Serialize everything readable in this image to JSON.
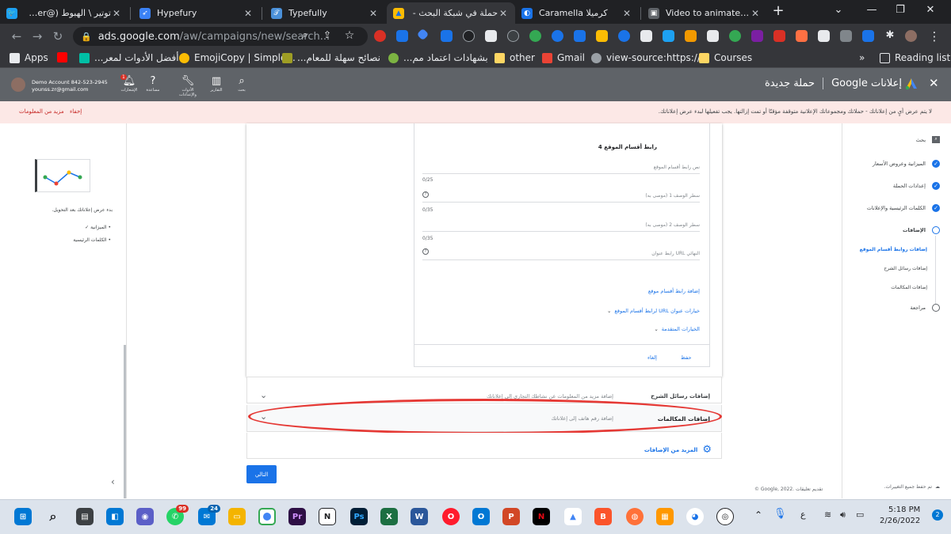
{
  "tabs": [
    {
      "label": "توتير \\ الهبوط (@anszaher",
      "icon": "twitter-icon"
    },
    {
      "label": "Hypefury",
      "icon": "hypefury-icon"
    },
    {
      "label": "Typefully",
      "icon": "typefully-icon"
    },
    {
      "label": "حملة في شبكة البحث -",
      "icon": "google-ads-icon",
      "active": true
    },
    {
      "label": "Caramella كرميلا",
      "icon": "caramella-icon"
    },
    {
      "label": "Video to animated GIF",
      "icon": "video-gif-icon"
    }
  ],
  "address": {
    "host": "ads.google.com",
    "path": "/aw/campaigns/new/search..."
  },
  "bookmarks": [
    "Apps",
    "أفضل الأدوات لمعر...",
    "EmojiCopy | Simple...",
    "نصائح سهلة للمعام...",
    "بشهادات اعتماد مم...",
    "other",
    "Gmail",
    "view-source:https://...",
    "Courses"
  ],
  "reading_list": "Reading list",
  "ads_header": {
    "product": "إعلانات Google",
    "page_title": "حملة جديدة",
    "account": "Demo Account 842-523-2945",
    "email": "younss.zr@gmail.com",
    "notification_count": "1",
    "icons": [
      {
        "name": "notifications-icon",
        "label": "الإشعارات"
      },
      {
        "name": "help-icon",
        "label": "مساعدة"
      },
      {
        "name": "tools-icon",
        "label": "الأدوات والإعدادات"
      },
      {
        "name": "reports-icon",
        "label": "التقارير"
      },
      {
        "name": "search-icon",
        "label": "بحث"
      }
    ]
  },
  "alert": {
    "message": "لا يتم عرض أيٍ من إعلاناتك - حملاتك ومجموعاتك الإعلانية متوقفة مؤقتًا أو تمت إزالتها. يجب تفعيلها لبدء عرض إعلاناتك.",
    "dismiss": "إخفاء",
    "more": "مزيد من المعلومات"
  },
  "left_nav": {
    "search": "بحث",
    "items": [
      {
        "label": "الميزانية وعروض الأسعار",
        "state": "done"
      },
      {
        "label": "إعدادات الحملة",
        "state": "done"
      },
      {
        "label": "الكلمات الرئيسية والإعلانات",
        "state": "done"
      },
      {
        "label": "الإضافات",
        "state": "current"
      },
      {
        "label": "مراجعة",
        "state": "todo"
      }
    ],
    "sub_items": [
      "إضافات روابط أقسام الموقع",
      "إضافات رسائل الشرح",
      "إضافات المكالمات"
    ],
    "saved": "تم حفظ جميع التغييرات."
  },
  "preview": {
    "caption": "بدء عرض إعلاناتك بعد التحويل.",
    "bullets": [
      "الميزانية ✓",
      "الكلمات الرئيسية"
    ]
  },
  "sitelink": {
    "title": "رابط أقسام الموقع 4",
    "text_placeholder": "نص رابط أقسام الموقع",
    "text_count": "0/25",
    "desc1_placeholder": "سطر الوصف 1 (موصى به)",
    "desc1_count": "0/35",
    "desc2_placeholder": "سطر الوصف 2 (موصى به)",
    "desc2_count": "0/35",
    "url_placeholder": "رابط عنوان URL النهائي",
    "add_link": "إضافة رابط أقسام موقع",
    "url_options": "خيارات عنوان URL لرابط أقسام الموقع",
    "advanced": "الخيارات المتقدمة",
    "save": "حفظ",
    "cancel": "إلغاء"
  },
  "extensions": {
    "callout_title": "إضافات رسائل الشرح",
    "callout_hint": "إضافة مزيد من المعلومات عن نشاطك التجاري إلى إعلاناتك",
    "call_title": "إضافات المكالمات",
    "call_hint": "إضافة رقم هاتف إلى إعلاناتك",
    "more": "المزيد من الإضافات"
  },
  "next_button": "التالي",
  "footer": "© Google, 2022. تقديم تعليقات",
  "taskbar": {
    "time": "5:18 PM",
    "date": "2/26/2022",
    "badges": {
      "whatsapp": "99",
      "mail": "24"
    },
    "notification_count": "2",
    "lang": "ع"
  },
  "colors": {
    "accent": "#1a73e8",
    "highlight": "#e53935",
    "header": "#5f6368",
    "alert_bg": "#fce8e6"
  }
}
